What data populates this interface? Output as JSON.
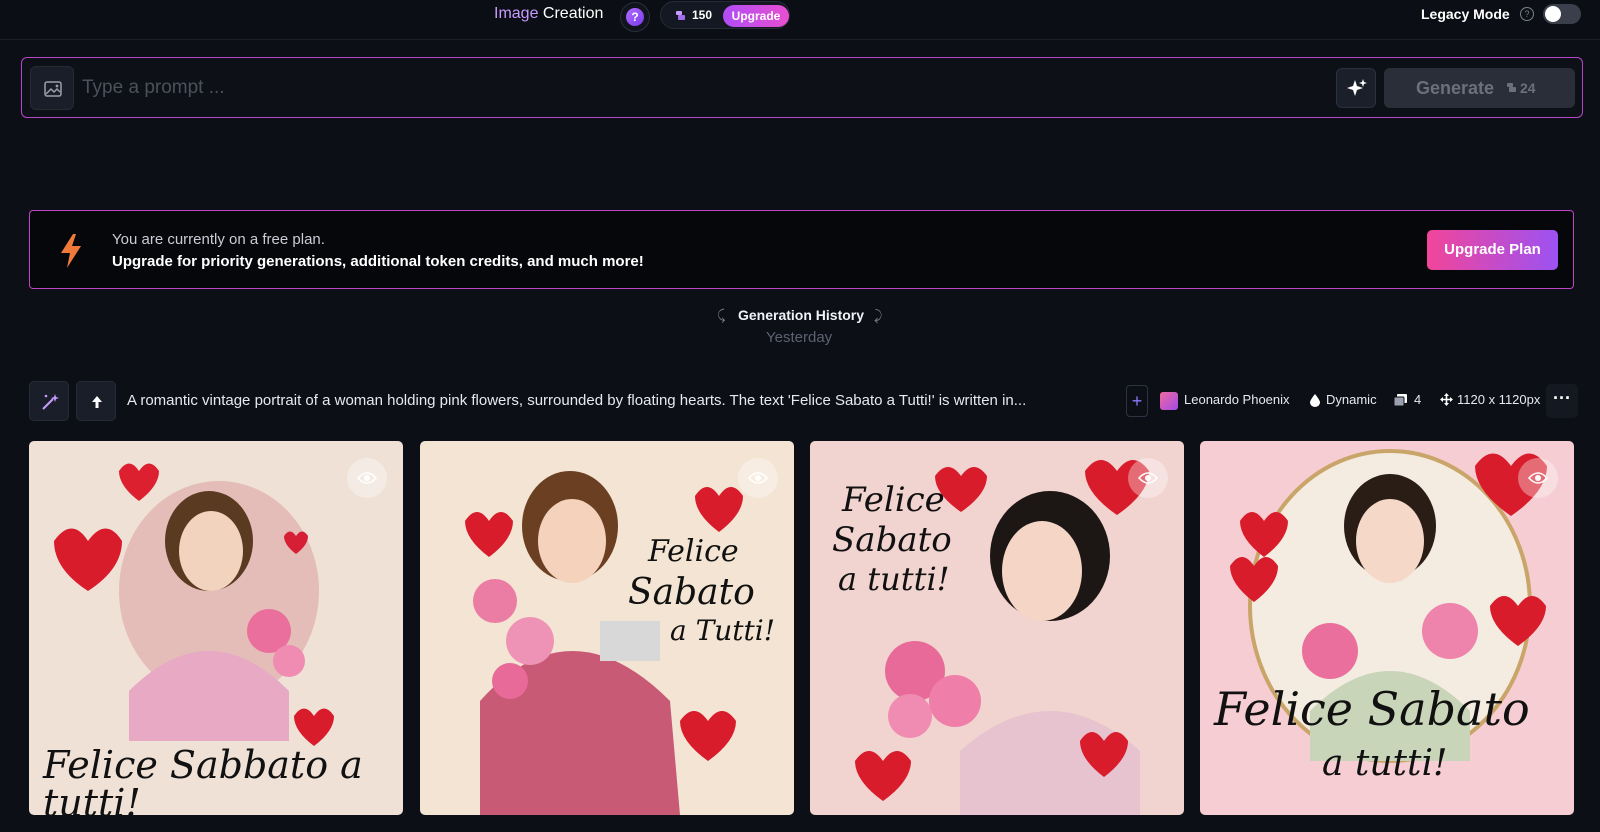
{
  "header": {
    "title_part1": "Image",
    "title_part2": "Creation",
    "help_glyph": "?",
    "token_count": "150",
    "upgrade_label": "Upgrade",
    "legacy_mode_label": "Legacy Mode",
    "legacy_help_glyph": "?",
    "legacy_mode_enabled": false
  },
  "prompt": {
    "placeholder": "Type a prompt ...",
    "value": "",
    "generate_label": "Generate",
    "generate_cost": "24"
  },
  "banner": {
    "line1": "You are currently on a free plan.",
    "line2": "Upgrade for priority generations, additional token credits, and much more!",
    "button_label": "Upgrade Plan"
  },
  "history": {
    "title": "Generation History",
    "date": "Yesterday"
  },
  "generation": {
    "prompt_text": "A romantic vintage portrait of a woman holding pink flowers, surrounded by floating hearts. The text 'Felice Sabato a Tutti!' is written in...",
    "model": "Leonardo Phoenix",
    "style": "Dynamic",
    "image_count": "4",
    "dimensions": "1120 x 1120px",
    "add_glyph": "+",
    "more_glyph": "···"
  },
  "images": [
    {
      "caption": "Felice Sabbato a tutti!",
      "bg": "#efe1d6"
    },
    {
      "caption_line1": "Felice",
      "caption_line2": "Sabato",
      "caption_line3": "a Tutti!",
      "bg": "#f3e4d3"
    },
    {
      "caption_line1": "Felice",
      "caption_line2": "Sabato",
      "caption_line3": "a tutti!",
      "bg": "#f1d3cf"
    },
    {
      "caption_line1": "Felice Sabato",
      "caption_line2": "a tutti!",
      "bg": "#f6cdd2"
    }
  ],
  "colors": {
    "accent_gradient_start": "#b14df6",
    "accent_gradient_end": "#e84fd1",
    "prompt_border": "#b347c7",
    "background": "#0c0f16"
  },
  "icons": [
    "help-icon",
    "token-icon",
    "image-upload-icon",
    "magic-sparkle-icon",
    "lightning-icon",
    "magic-wand-icon",
    "upload-arrow-icon",
    "add-icon",
    "droplet-icon",
    "images-icon",
    "resize-icon",
    "more-icon",
    "eye-icon"
  ]
}
